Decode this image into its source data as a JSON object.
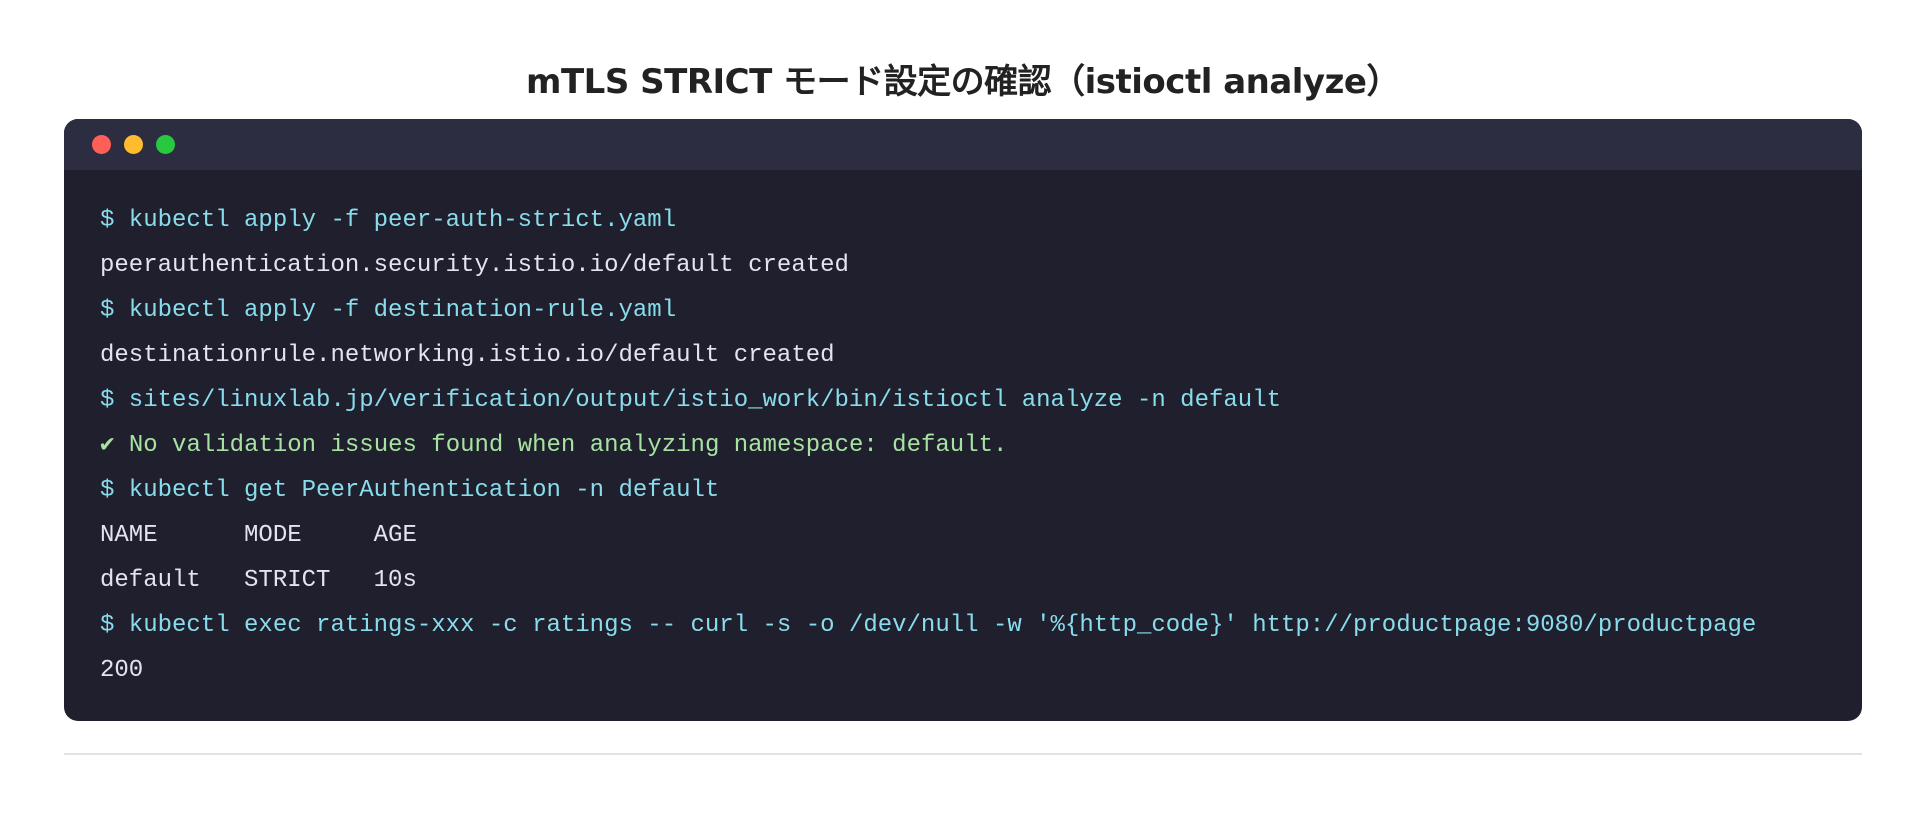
{
  "page": {
    "title": "mTLS STRICT モード設定の確認（istioctl analyze）"
  },
  "terminal": {
    "lines": [
      {
        "kind": "cmd",
        "text": "$ kubectl apply -f peer-auth-strict.yaml"
      },
      {
        "kind": "out",
        "text": "peerauthentication.security.istio.io/default created"
      },
      {
        "kind": "cmd",
        "text": "$ kubectl apply -f destination-rule.yaml"
      },
      {
        "kind": "out",
        "text": "destinationrule.networking.istio.io/default created"
      },
      {
        "kind": "cmd",
        "text": "$ sites/linuxlab.jp/verification/output/istio_work/bin/istioctl analyze -n default"
      },
      {
        "kind": "ok",
        "text": "✔ No validation issues found when analyzing namespace: default."
      },
      {
        "kind": "cmd",
        "text": "$ kubectl get PeerAuthentication -n default"
      },
      {
        "kind": "out",
        "text": "NAME      MODE     AGE"
      },
      {
        "kind": "out",
        "text": "default   STRICT   10s"
      },
      {
        "kind": "cmd",
        "text": "$ kubectl exec ratings-xxx -c ratings -- curl -s -o /dev/null -w '%{http_code}' http://productpage:9080/productpage"
      },
      {
        "kind": "out",
        "text": "200"
      }
    ]
  },
  "colors": {
    "terminal_bg": "#1f1f2e",
    "titlebar_bg": "#2d2d42",
    "command": "#89dceb",
    "output": "#e4e4ef",
    "success": "#a6e3a1",
    "close_dot": "#ff5f57",
    "minimize_dot": "#febc2e",
    "maximize_dot": "#28c840"
  }
}
